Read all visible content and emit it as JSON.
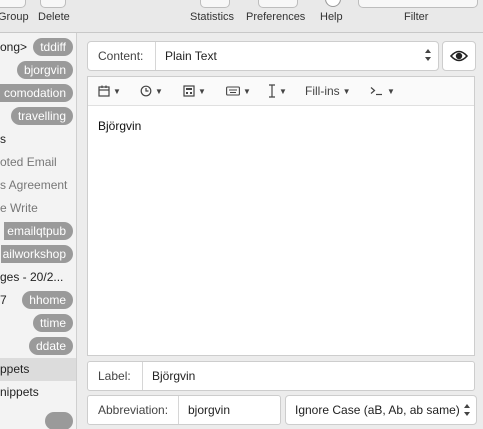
{
  "toolbar": {
    "group_label": "Group",
    "delete_label": "Delete",
    "statistics_label": "Statistics",
    "preferences_label": "Preferences",
    "help_label": "Help",
    "filter_label": "Filter"
  },
  "sidebar": {
    "rows": [
      {
        "text": "ong>",
        "pill": "tddiff"
      },
      {
        "text": "",
        "pill": "bjorgvin"
      },
      {
        "text": "",
        "pill": "comodation"
      },
      {
        "text": "",
        "pill": "travelling"
      },
      {
        "text": "s",
        "pill": ""
      },
      {
        "text": "oted Email",
        "pill": ""
      },
      {
        "text": "s Agreement",
        "pill": ""
      },
      {
        "text": "e Write",
        "pill": ""
      },
      {
        "text": "",
        "pill": "emailqtpub"
      },
      {
        "text": "",
        "pill": "ailworkshop"
      },
      {
        "text": "ges - 20/2...",
        "pill": ""
      },
      {
        "text": "7",
        "pill": "hhome"
      },
      {
        "text": "",
        "pill": "ttime"
      },
      {
        "text": "",
        "pill": "ddate"
      },
      {
        "text": "ppets",
        "pill": ""
      },
      {
        "text": "nippets",
        "pill": ""
      }
    ]
  },
  "content": {
    "label": "Content:",
    "value": "Plain Text"
  },
  "editor": {
    "tools": {
      "fillins": "Fill-ins"
    },
    "text": "Björgvin"
  },
  "label_field": {
    "label": "Label:",
    "value": "Björgvin"
  },
  "abbreviation": {
    "label": "Abbreviation:",
    "value": "bjorgvin"
  },
  "case_option": {
    "value": "Ignore Case (aB, Ab, ab same)"
  },
  "colors": {
    "pill": "#9a9a9a",
    "selected_row": "#dcdcdc"
  }
}
